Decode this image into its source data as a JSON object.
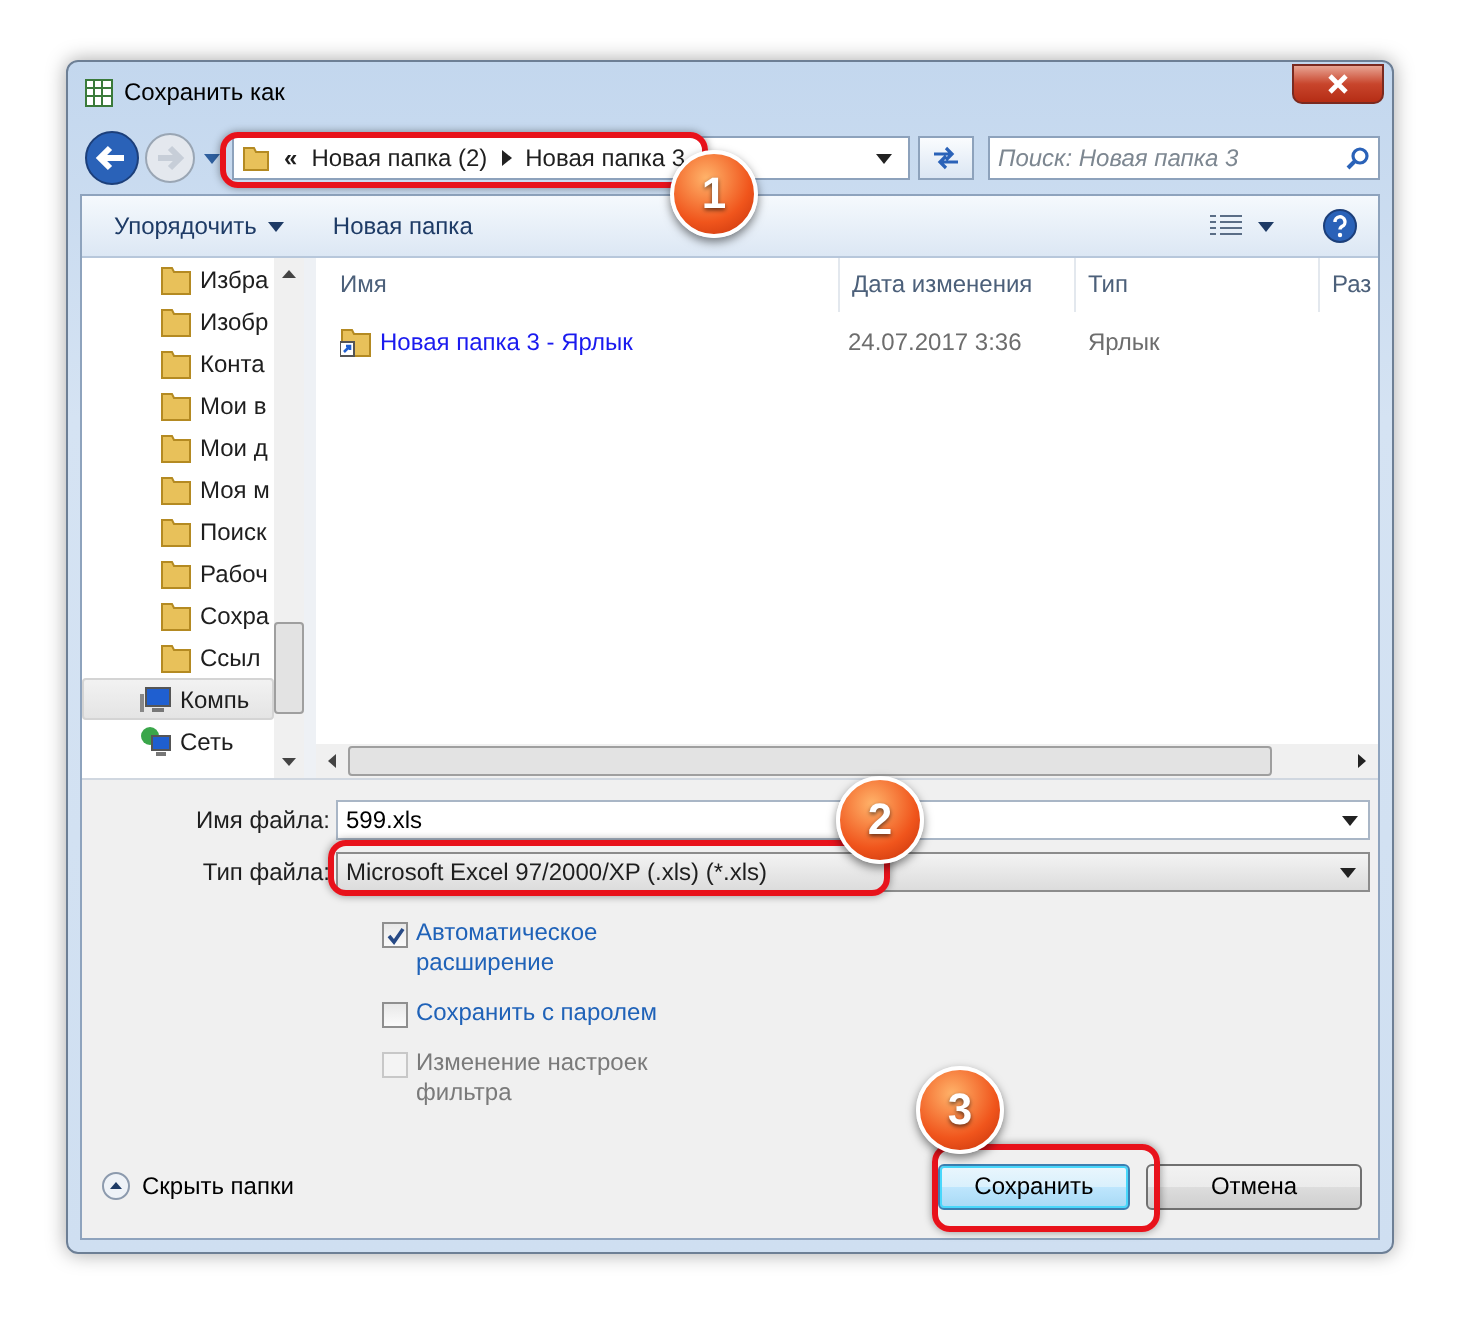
{
  "window": {
    "title": "Сохранить как"
  },
  "address": {
    "overflow": "«",
    "crumbs": [
      "Новая папка (2)",
      "Новая папка 3"
    ]
  },
  "search": {
    "placeholder": "Поиск: Новая папка 3"
  },
  "toolbar": {
    "organize": "Упорядочить",
    "new_folder": "Новая папка"
  },
  "nav_tree": [
    {
      "label": "Избра",
      "kind": "folder",
      "selected": false
    },
    {
      "label": "Изобр",
      "kind": "folder",
      "selected": false
    },
    {
      "label": "Конта",
      "kind": "folder",
      "selected": false
    },
    {
      "label": "Мои в",
      "kind": "folder",
      "selected": false
    },
    {
      "label": "Мои д",
      "kind": "folder",
      "selected": false
    },
    {
      "label": "Моя м",
      "kind": "folder",
      "selected": false
    },
    {
      "label": "Поиск",
      "kind": "folder",
      "selected": false
    },
    {
      "label": "Рабоч",
      "kind": "folder",
      "selected": false
    },
    {
      "label": "Сохра",
      "kind": "folder",
      "selected": false
    },
    {
      "label": "Ссыл",
      "kind": "folder",
      "selected": false
    },
    {
      "label": "Компь",
      "kind": "computer",
      "selected": true
    },
    {
      "label": "Сеть",
      "kind": "network",
      "selected": false
    }
  ],
  "table": {
    "columns": [
      "Имя",
      "Дата изменения",
      "Тип",
      "Раз"
    ],
    "rows": [
      {
        "name": "Новая папка 3 - Ярлык",
        "date": "24.07.2017 3:36",
        "type": "Ярлык"
      }
    ]
  },
  "file_name": {
    "label": "Имя файла:",
    "value": "599.xls"
  },
  "file_type": {
    "label": "Тип файла:",
    "value": "Microsoft Excel 97/2000/XP (.xls) (*.xls)"
  },
  "options": [
    {
      "label": "Автоматическое расширение",
      "checked": true,
      "disabled": false
    },
    {
      "label": "Сохранить с паролем",
      "checked": false,
      "disabled": false
    },
    {
      "label": "Изменение настроек фильтра",
      "checked": false,
      "disabled": true
    }
  ],
  "hide_folders": "Скрыть папки",
  "buttons": [
    {
      "label": "Сохранить",
      "default": true
    },
    {
      "label": "Отмена",
      "default": false
    }
  ],
  "callouts": [
    "1",
    "2",
    "3"
  ]
}
